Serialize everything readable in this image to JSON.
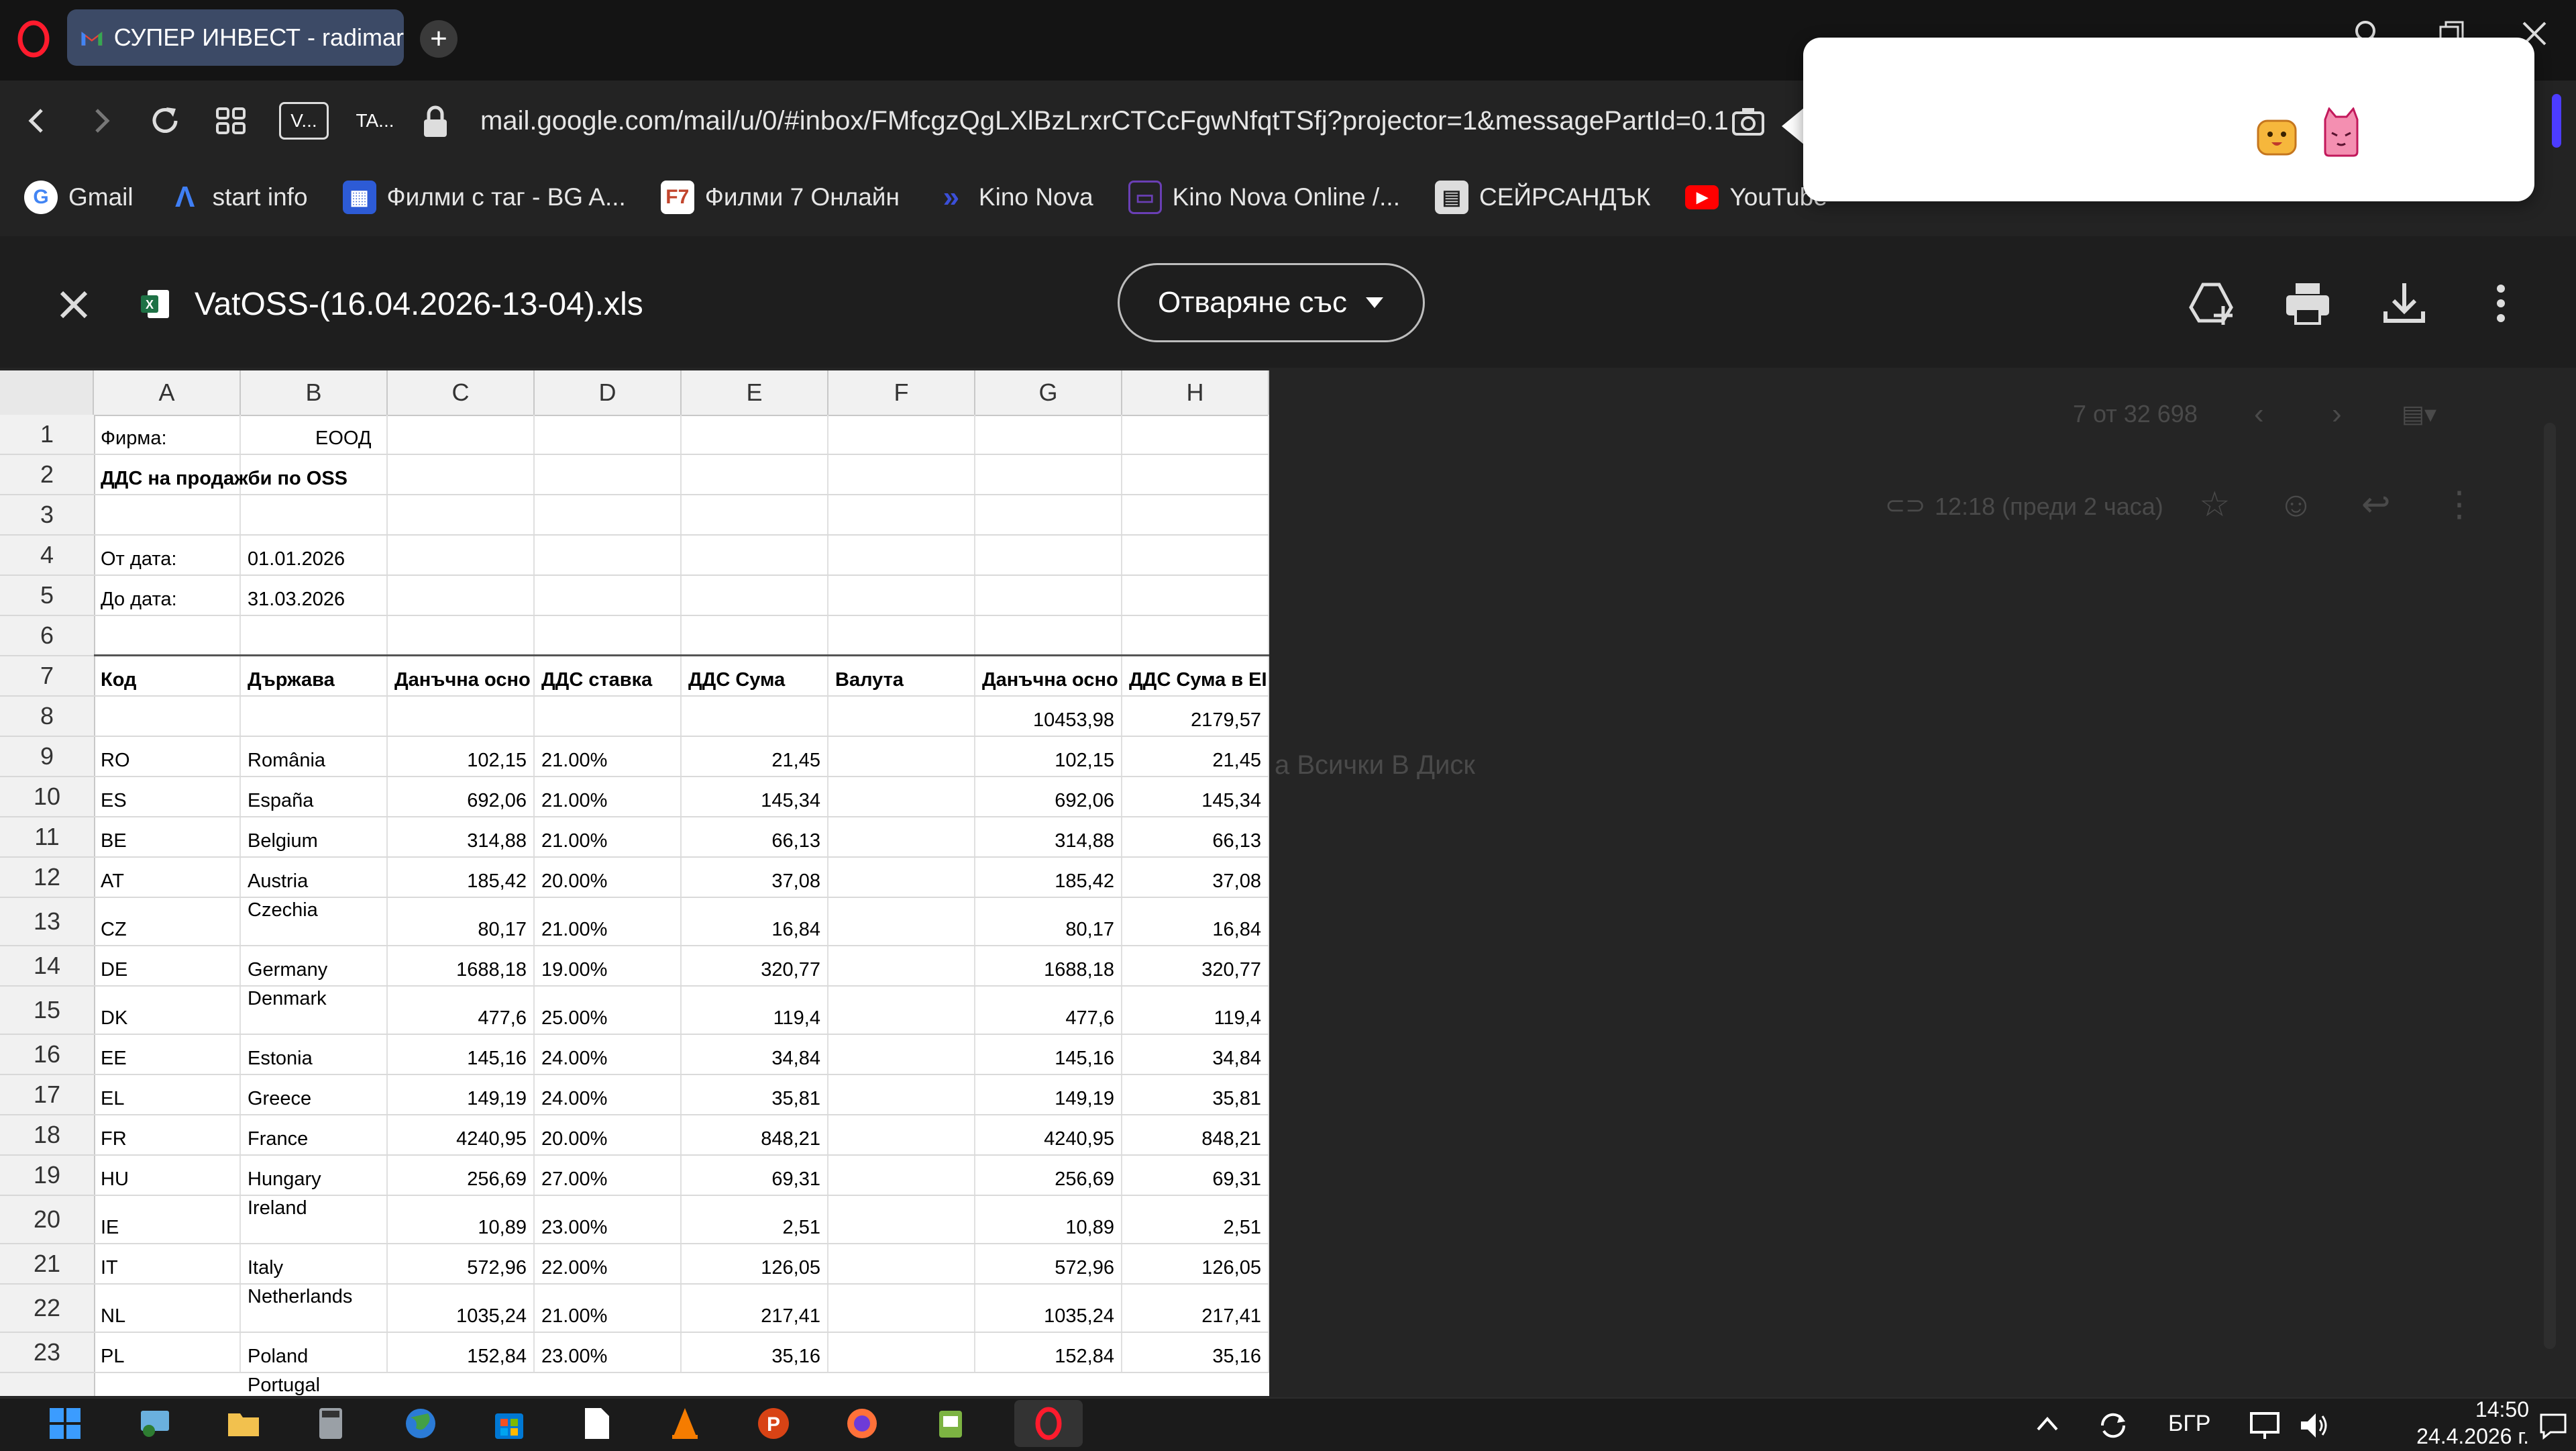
{
  "browser": {
    "tab_title": "СУПЕР ИНВЕСТ - radimar",
    "new_tab": "+",
    "vtab_label": "V...",
    "tatab_label": "TA...",
    "url": "mail.google.com/mail/u/0/#inbox/FMfcgzQgLXlBzLrxrCTCcFgwNfqtTSfj?projector=1&messagePartId=0.1"
  },
  "bookmarks": [
    {
      "label": "Gmail",
      "icon": "google-icon",
      "color": "#4285f4"
    },
    {
      "label": "start info",
      "icon": "start-info-icon",
      "color": "#3f7ff5"
    },
    {
      "label": "Филми с таг - BG A...",
      "icon": "film-tag-icon",
      "color": "#2d5bd6"
    },
    {
      "label": "Филми 7 Онлайн",
      "icon": "f7-icon",
      "color": "#c2452d"
    },
    {
      "label": "Kino Nova",
      "icon": "kino-nova-icon",
      "color": "#3b4fd8"
    },
    {
      "label": "Kino Nova Online /...",
      "icon": "kino-nova-online-icon",
      "color": "#6a3fb5"
    },
    {
      "label": "СЕЙРСАНДЪК",
      "icon": "seirsandak-icon",
      "color": "#777777"
    },
    {
      "label": "YouTube",
      "icon": "youtube-icon",
      "color": "#ff0000"
    }
  ],
  "viewer": {
    "filename": "VatOSS-(16.04.2026-13-04).xls",
    "open_with": "Отваряне със"
  },
  "gmail_bg": {
    "counter": "7 от 32 698",
    "time": "12:18 (преди 2 часа)",
    "drive_text": "а Всички В Диск"
  },
  "sheet": {
    "columns": [
      "A",
      "B",
      "C",
      "D",
      "E",
      "F",
      "G",
      "H"
    ],
    "row_numbers": [
      "1",
      "2",
      "3",
      "4",
      "5",
      "6",
      "7",
      "8",
      "9",
      "10",
      "11",
      "12",
      "13",
      "14",
      "15",
      "16",
      "17",
      "18",
      "19",
      "20",
      "21",
      "22",
      "23"
    ],
    "firm_label": "Фирма: ",
    "firm_suffix": " ЕООД",
    "title": "ДДС на продажби по OSS",
    "from_label": "От дата:",
    "from_value": "01.01.2026",
    "to_label": "До дата:",
    "to_value": "31.03.2026",
    "headers": [
      "Код",
      "Държава",
      "Данъчна осно",
      "ДДС ставка",
      "ДДС Сума",
      "Валута",
      "Данъчна осно",
      "ДДС Сума в EI"
    ],
    "totals": {
      "base": "10453,98",
      "vat": "2179,57"
    },
    "rows": [
      {
        "code": "RO",
        "country": "România",
        "base": "102,15",
        "rate": "21.00%",
        "vat": "21,45",
        "base_eur": "102,15",
        "vat_eur": "21,45"
      },
      {
        "code": "ES",
        "country": "España",
        "base": "692,06",
        "rate": "21.00%",
        "vat": "145,34",
        "base_eur": "692,06",
        "vat_eur": "145,34"
      },
      {
        "code": "BE",
        "country": "Belgium",
        "base": "314,88",
        "rate": "21.00%",
        "vat": "66,13",
        "base_eur": "314,88",
        "vat_eur": "66,13"
      },
      {
        "code": "AT",
        "country": "Austria",
        "base": "185,42",
        "rate": "20.00%",
        "vat": "37,08",
        "base_eur": "185,42",
        "vat_eur": "37,08"
      },
      {
        "code": "CZ",
        "country": "Czechia",
        "base": "80,17",
        "rate": "21.00%",
        "vat": "16,84",
        "base_eur": "80,17",
        "vat_eur": "16,84"
      },
      {
        "code": "DE",
        "country": "Germany",
        "base": "1688,18",
        "rate": "19.00%",
        "vat": "320,77",
        "base_eur": "1688,18",
        "vat_eur": "320,77"
      },
      {
        "code": "DK",
        "country": "Denmark",
        "base": "477,6",
        "rate": "25.00%",
        "vat": "119,4",
        "base_eur": "477,6",
        "vat_eur": "119,4"
      },
      {
        "code": "EE",
        "country": "Estonia",
        "base": "145,16",
        "rate": "24.00%",
        "vat": "34,84",
        "base_eur": "145,16",
        "vat_eur": "34,84"
      },
      {
        "code": "EL",
        "country": "Greece",
        "base": "149,19",
        "rate": "24.00%",
        "vat": "35,81",
        "base_eur": "149,19",
        "vat_eur": "35,81"
      },
      {
        "code": "FR",
        "country": "France",
        "base": "4240,95",
        "rate": "20.00%",
        "vat": "848,21",
        "base_eur": "4240,95",
        "vat_eur": "848,21"
      },
      {
        "code": "HU",
        "country": "Hungary",
        "base": "256,69",
        "rate": "27.00%",
        "vat": "69,31",
        "base_eur": "256,69",
        "vat_eur": "69,31"
      },
      {
        "code": "IE",
        "country": "Ireland",
        "base": "10,89",
        "rate": "23.00%",
        "vat": "2,51",
        "base_eur": "10,89",
        "vat_eur": "2,51"
      },
      {
        "code": "IT",
        "country": "Italy",
        "base": "572,96",
        "rate": "22.00%",
        "vat": "126,05",
        "base_eur": "572,96",
        "vat_eur": "126,05"
      },
      {
        "code": "NL",
        "country": "Netherlands",
        "base": "1035,24",
        "rate": "21.00%",
        "vat": "217,41",
        "base_eur": "1035,24",
        "vat_eur": "217,41"
      },
      {
        "code": "PL",
        "country": "Poland",
        "base": "152,84",
        "rate": "23.00%",
        "vat": "35,16",
        "base_eur": "152,84",
        "vat_eur": "35,16"
      }
    ],
    "next_country": "Portugal"
  },
  "taskbar": {
    "language": "БГР",
    "time": "14:50",
    "date": "24.4.2026 г."
  },
  "colors": {
    "tab_active": "#3c4a66",
    "excel_green": "#1e7145",
    "opera_red": "#ff1b2d"
  }
}
